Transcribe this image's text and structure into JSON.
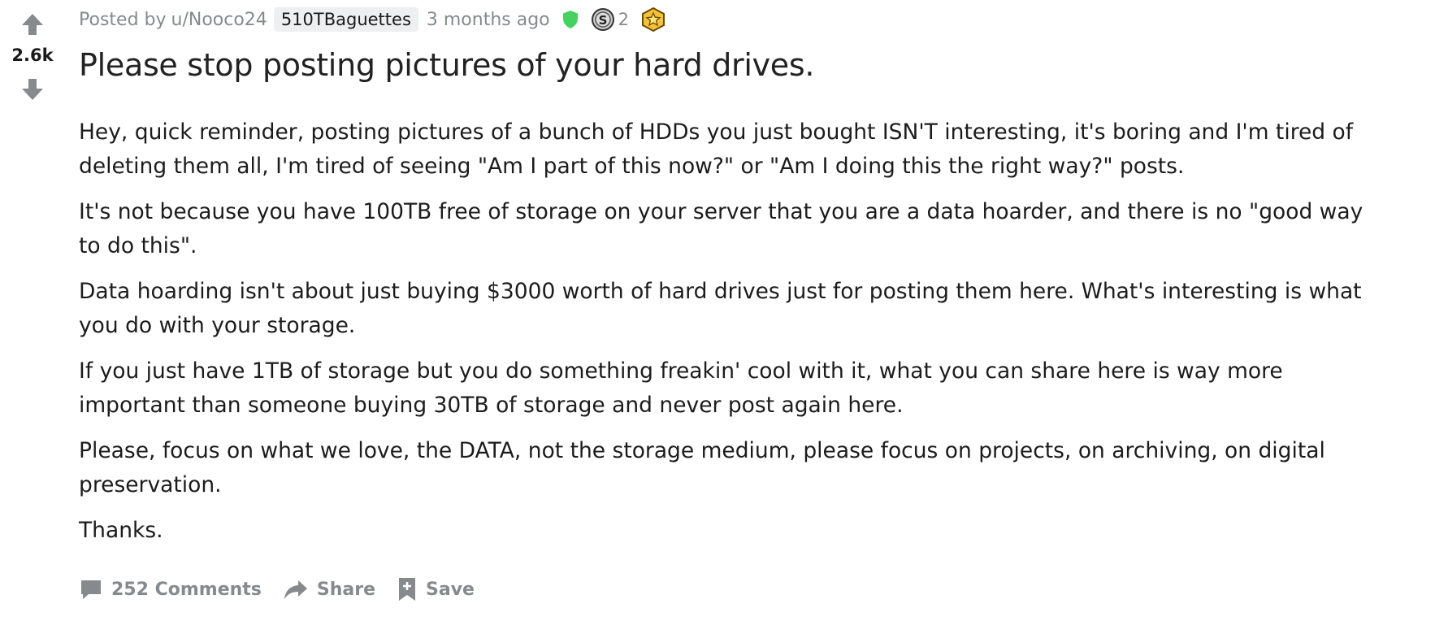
{
  "vote": {
    "count": "2.6k"
  },
  "meta": {
    "posted_by": "Posted by",
    "author": "u/Nooco24",
    "flair": "510TBaguettes",
    "time": "3 months ago",
    "award_count": "2"
  },
  "post": {
    "title": "Please stop posting pictures of your hard drives.",
    "paragraphs": [
      "Hey, quick reminder, posting pictures of a bunch of HDDs you just bought ISN'T interesting, it's boring and I'm tired of deleting them all, I'm tired of seeing \"Am I part of this now?\" or \"Am I doing this the right way?\" posts.",
      "It's not because you have 100TB free of storage on your server that you are a data hoarder, and there is no \"good way to do this\".",
      "Data hoarding isn't about just buying $3000 worth of hard drives just for posting them here. What's interesting is what you do with your storage.",
      "If you just have 1TB of storage but you do something freakin' cool with it, what you can share here is way more important than someone buying 30TB of storage and never post again here.",
      "Please, focus on what we love, the DATA, not the storage medium, please focus on projects, on archiving, on digital preservation.",
      "Thanks."
    ]
  },
  "actions": {
    "comments_label": "252 Comments",
    "share_label": "Share",
    "save_label": "Save"
  },
  "icons": {
    "upvote": "upvote-arrow-icon",
    "downvote": "downvote-arrow-icon",
    "moderator": "shield-icon",
    "silver_award": "silver-award-icon",
    "gold_award": "gold-award-icon",
    "comment": "comment-bubble-icon",
    "share": "share-arrow-icon",
    "save": "bookmark-plus-icon"
  },
  "colors": {
    "muted_text": "#878a8c",
    "vote_arrow": "#878a8c",
    "mod_shield": "#46d160",
    "gold": "#f5c03a",
    "flair_bg": "#edeff1"
  }
}
